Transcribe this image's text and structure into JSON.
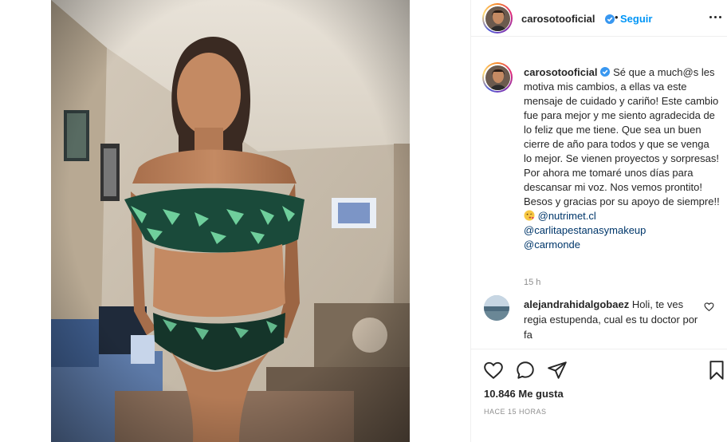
{
  "post": {
    "author": "carosotooficial",
    "follow_label": "Seguir",
    "dot": "•"
  },
  "caption": {
    "author": "carosotooficial",
    "text": "Sé que a much@s les motiva mis cambios, a ellas va este mensaje de cuidado y cariño! Este cambio fue para mejor y me siento agradecida de lo feliz que me tiene. Que sea un buen cierre de año para todos y que se venga lo mejor. Se vienen proyectos y sorpresas! Por ahora me tomaré unos días para descansar mi voz. Nos vemos prontito! Besos y gracias por su apoyo de siempre!!",
    "emoji": "kiss-emoji",
    "mentions": [
      "@nutrimet.cl",
      "@carlitapestanasymakeup",
      "@carmonde"
    ],
    "time": "15 h"
  },
  "comment": {
    "author": "alejandrahidalgobaez",
    "text": "Holi, te ves regia estupenda, cual es tu doctor por fa"
  },
  "actions": {
    "likes": "10.846 Me gusta",
    "time_ago": "HACE 15 HORAS"
  },
  "colors": {
    "link": "#0095f6",
    "mention": "#00376b",
    "muted": "#8e8e8e",
    "verified": "#3897f0"
  }
}
